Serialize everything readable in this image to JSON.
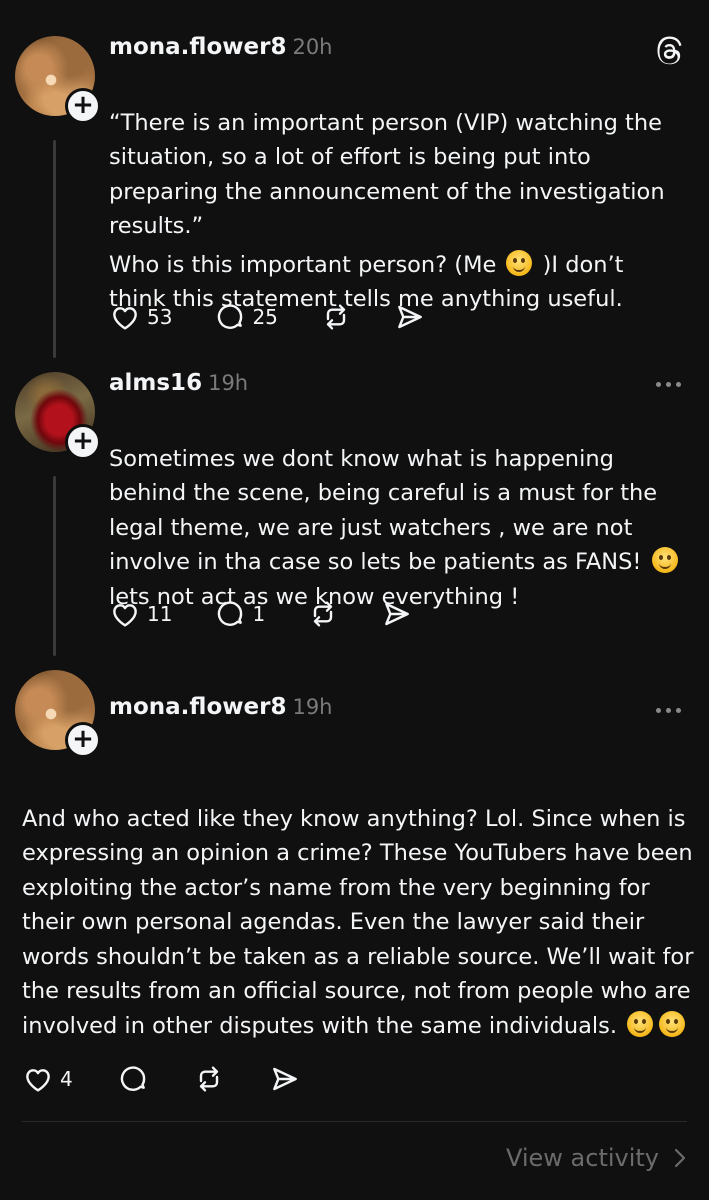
{
  "posts": [
    {
      "username": "mona.flower8",
      "time": "20h",
      "text": "“There is an important person (VIP) watching the situation, so a lot of effort is being put into preparing the announcement of the investigation results.”",
      "text2a": "Who is this important person? (Me ",
      "text2b": " )I don’t\nthink this statement tells me anything useful.",
      "likes": "53",
      "replies": "25"
    },
    {
      "username": "alms16",
      "time": "19h",
      "text_a": "Sometimes we dont know what is happening behind the scene, being careful is a must for the legal theme, we are just watchers , we are not involve in tha case so lets be patients as FANS! ",
      "text_b": "\nlets not act as we know everything !",
      "likes": "11",
      "replies": "1"
    },
    {
      "username": "mona.flower8",
      "time": "19h",
      "text": "And who acted like they know anything? Lol. Since when is expressing an opinion a crime? These YouTubers have been exploiting the actor’s name from the very beginning for their own personal agendas. Even the lawyer said their words shouldn’t be taken as a reliable source. We’ll wait for the results from an official source, not from people who are involved in other disputes with the same individuals. ",
      "likes": "4"
    }
  ],
  "footer": {
    "view_activity": "View activity"
  },
  "icons": {
    "like": "heart-icon",
    "reply": "comment-icon",
    "repost": "repost-icon",
    "share": "send-icon",
    "more": "more-dots-icon",
    "logo": "threads-logo-icon"
  }
}
